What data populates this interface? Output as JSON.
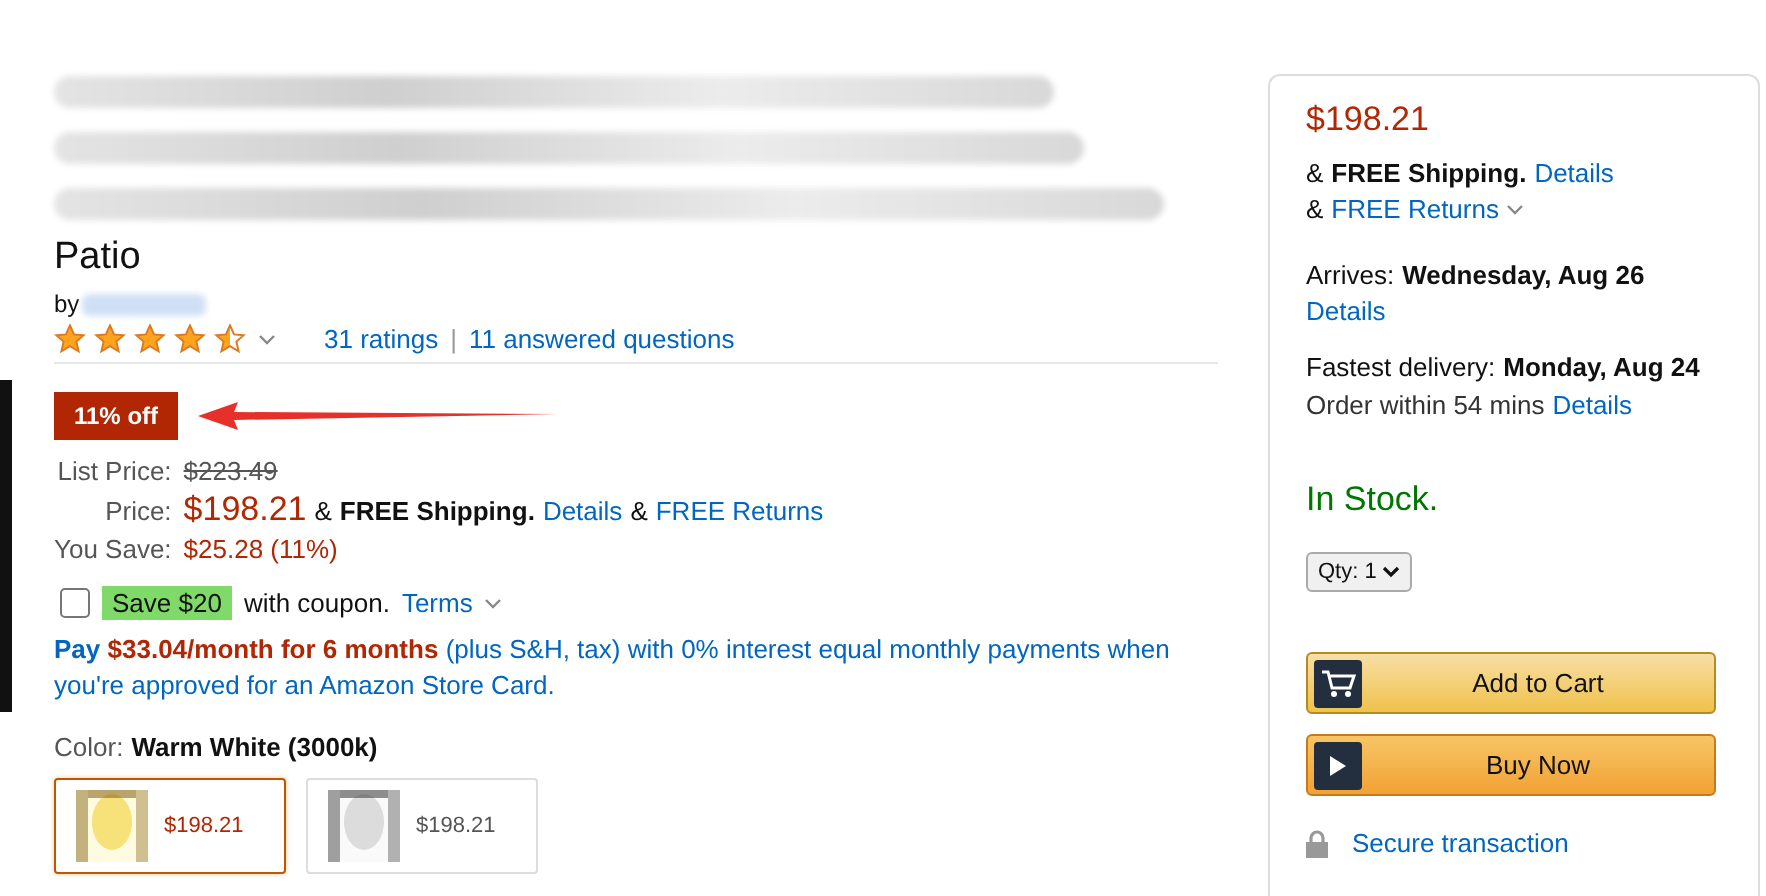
{
  "product": {
    "title_end": "Patio",
    "byline": "by",
    "stars": 4.5,
    "ratings": "31 ratings",
    "separator": "|",
    "questions": "11 answered questions"
  },
  "deal_badge": "11% off",
  "pricing": {
    "list_price_label": "List Price:",
    "list_price": "$223.49",
    "price_label": "Price:",
    "price": "$198.21",
    "shipping_amp": "&",
    "shipping": "FREE Shipping",
    "shipping_dot": ".",
    "details": "Details",
    "returns_amp": "&",
    "returns": "FREE Returns",
    "you_save_label": "You Save:",
    "you_save": "$25.28 (11%)"
  },
  "coupon": {
    "checked": false,
    "badge": "Save $20",
    "text": "with coupon.",
    "terms": "Terms"
  },
  "financing": {
    "pay": "Pay",
    "amount": "$33.04/month for 6 months",
    "rest": "(plus S&H, tax) with 0% interest equal monthly payments when you're approved for an Amazon Store Card."
  },
  "color": {
    "label": "Color:",
    "value": "Warm White (3000k)",
    "swatches": [
      {
        "selected": true,
        "kind": "warm",
        "price": "$198.21"
      },
      {
        "selected": false,
        "kind": "cool",
        "price": "$198.21"
      }
    ]
  },
  "buy_box": {
    "price": "$198.21",
    "shipping_amp": "&",
    "shipping": "FREE Shipping",
    "shipping_dot": ".",
    "shipping_details": "Details",
    "returns_amp": "&",
    "returns": "FREE Returns",
    "arrives_label": "Arrives:",
    "arrives_date": "Wednesday, Aug 26",
    "arrives_details": "Details",
    "fastest_label": "Fastest delivery:",
    "fastest_date": "Monday, Aug 24",
    "order_within": "Order within 54 mins",
    "order_details": "Details",
    "stock": "In Stock.",
    "qty_label": "Qty:",
    "qty_value": "1",
    "add_to_cart": "Add to Cart",
    "buy_now": "Buy Now",
    "secure": "Secure transaction"
  }
}
